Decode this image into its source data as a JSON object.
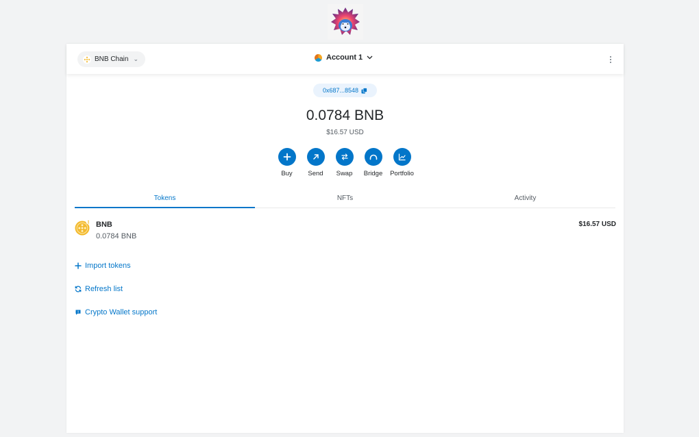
{
  "header": {
    "network": "BNB Chain",
    "account": "Account 1"
  },
  "wallet": {
    "address": "0x687...8548",
    "balance": "0.0784 BNB",
    "fiat_balance": "$16.57 USD"
  },
  "actions": [
    {
      "label": "Buy",
      "icon": "plus-icon"
    },
    {
      "label": "Send",
      "icon": "arrow-up-right-icon"
    },
    {
      "label": "Swap",
      "icon": "swap-icon"
    },
    {
      "label": "Bridge",
      "icon": "bridge-icon"
    },
    {
      "label": "Portfolio",
      "icon": "chart-icon"
    }
  ],
  "tabs": [
    {
      "label": "Tokens",
      "active": true
    },
    {
      "label": "NFTs",
      "active": false
    },
    {
      "label": "Activity",
      "active": false
    }
  ],
  "tokens": [
    {
      "name": "BNB",
      "amount": "0.0784 BNB",
      "fiat": "$16.57 USD",
      "icon": "bnb-token-icon"
    }
  ],
  "links": {
    "import": "Import tokens",
    "refresh": "Refresh list",
    "support": "Crypto Wallet support"
  },
  "colors": {
    "accent": "#0376c9",
    "bnb": "#f3ba2f",
    "background": "#f2f3f4"
  }
}
